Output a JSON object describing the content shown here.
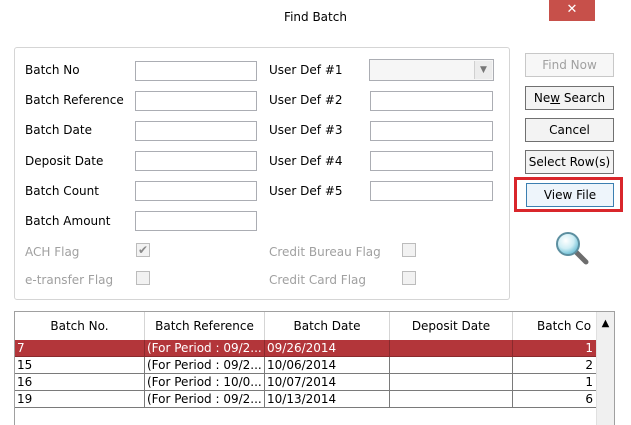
{
  "window": {
    "title": "Find Batch",
    "close_glyph": "✕"
  },
  "form": {
    "batch_no_label": "Batch No",
    "batch_ref_label": "Batch Reference",
    "batch_date_label": "Batch Date",
    "deposit_date_label": "Deposit Date",
    "batch_count_label": "Batch Count",
    "batch_amount_label": "Batch Amount",
    "user_def1_label": "User Def #1",
    "user_def2_label": "User Def #2",
    "user_def3_label": "User Def #3",
    "user_def4_label": "User Def #4",
    "user_def5_label": "User Def #5",
    "ach_flag_label": "ACH Flag",
    "etransfer_flag_label": "e-transfer Flag",
    "credit_bureau_flag_label": "Credit Bureau Flag",
    "credit_card_flag_label": "Credit Card Flag",
    "ach_checked_glyph": "✔"
  },
  "buttons": {
    "find_now": "Find Now",
    "new_search_pre": "Ne",
    "new_search_mnemonic": "w",
    "new_search_post": " Search",
    "cancel": "Cancel",
    "select_rows": "Select Row(s)",
    "view_file": "View File"
  },
  "grid": {
    "columns": [
      "Batch No.",
      "Batch Reference",
      "Batch Date",
      "Deposit Date",
      "Batch Co"
    ],
    "rows": [
      {
        "batch_no": "7",
        "reference": "(For Period : 09/2...",
        "batch_date": "09/26/2014",
        "deposit_date": "",
        "count": "1"
      },
      {
        "batch_no": "15",
        "reference": "(For Period : 09/2...",
        "batch_date": "10/06/2014",
        "deposit_date": "",
        "count": "2"
      },
      {
        "batch_no": "16",
        "reference": "(For Period : 10/0...",
        "batch_date": "10/07/2014",
        "deposit_date": "",
        "count": "1"
      },
      {
        "batch_no": "19",
        "reference": "(For Period : 09/2...",
        "batch_date": "10/13/2014",
        "deposit_date": "",
        "count": "6"
      }
    ],
    "selected_row": 0,
    "scroll_up_glyph": "▲"
  },
  "icons": {
    "search_magnifier": "magnifier-icon"
  },
  "colors": {
    "selection": "#b3363a",
    "highlight_box": "#d9262b",
    "close_button": "#c7504a"
  }
}
